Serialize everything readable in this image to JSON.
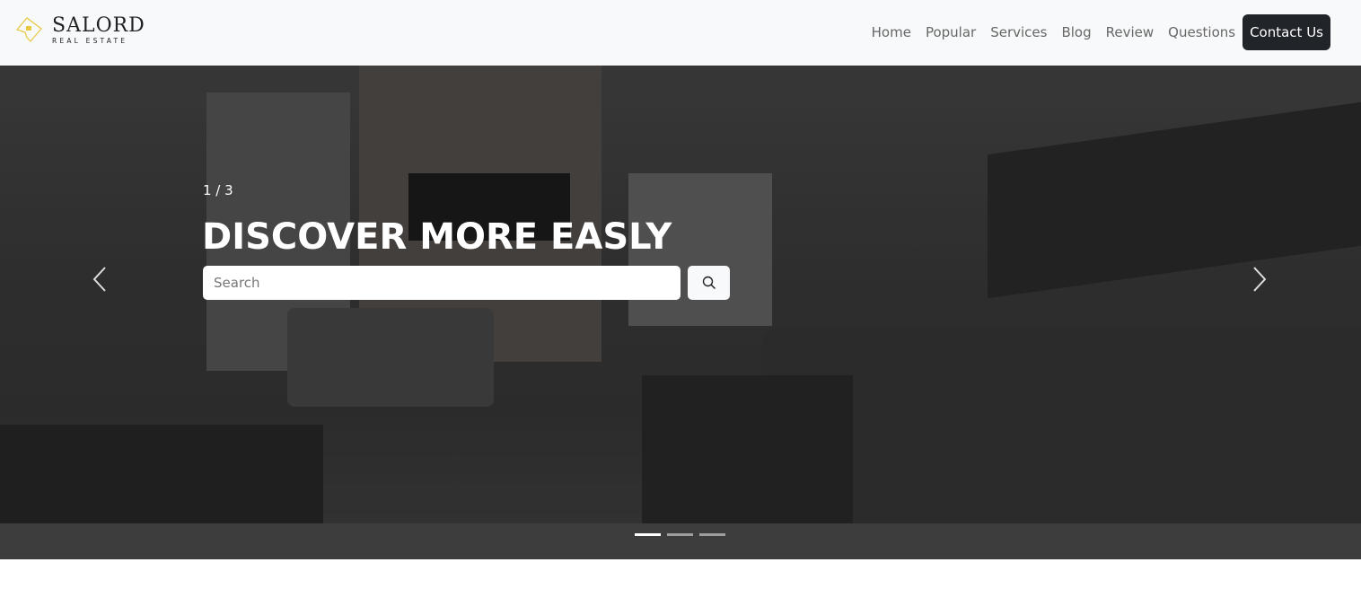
{
  "brand": {
    "name": "SALORD",
    "tagline": "REAL ESTATE",
    "accent": "#e8c840"
  },
  "nav": {
    "items": [
      {
        "label": "Home"
      },
      {
        "label": "Popular"
      },
      {
        "label": "Services"
      },
      {
        "label": "Blog"
      },
      {
        "label": "Review"
      },
      {
        "label": "Questions"
      }
    ],
    "contact_label": "Contact Us"
  },
  "hero": {
    "counter": "1 / 3",
    "headline": "DISCOVER MORE EASLY",
    "search_placeholder": "Search",
    "slides_total": 3,
    "active_slide": 1
  }
}
